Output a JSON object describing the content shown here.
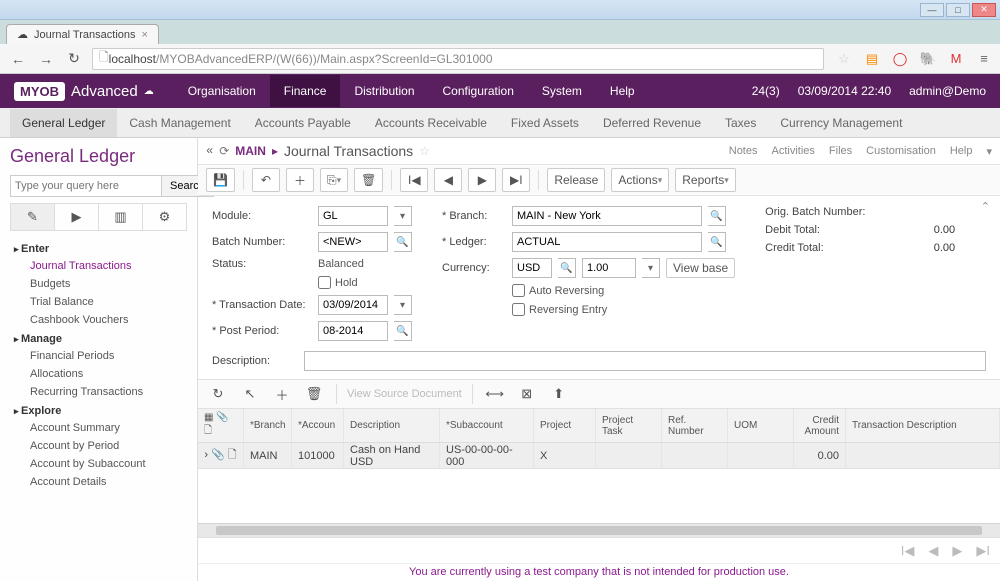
{
  "browser": {
    "tab_title": "Journal Transactions",
    "url_host": "localhost",
    "url_path": "/MYOBAdvancedERP/(W(66))/Main.aspx?ScreenId=GL301000"
  },
  "header": {
    "logo_badge": "MYOB",
    "logo_text": "Advanced",
    "nav": [
      "Organisation",
      "Finance",
      "Distribution",
      "Configuration",
      "System",
      "Help"
    ],
    "nav_active": 1,
    "notif": "24(3)",
    "datetime": "03/09/2014 22:40",
    "user": "admin@Demo"
  },
  "subnav": {
    "items": [
      "General Ledger",
      "Cash Management",
      "Accounts Payable",
      "Accounts Receivable",
      "Fixed Assets",
      "Deferred Revenue",
      "Taxes",
      "Currency Management"
    ],
    "active": 0
  },
  "sidebar": {
    "title": "General Ledger",
    "search_placeholder": "Type your query here",
    "search_btn": "Search",
    "groups": [
      {
        "label": "Enter",
        "items": [
          "Journal Transactions",
          "Budgets",
          "Trial Balance",
          "Cashbook Vouchers"
        ],
        "active": 0
      },
      {
        "label": "Manage",
        "items": [
          "Financial Periods",
          "Allocations",
          "Recurring Transactions"
        ]
      },
      {
        "label": "Explore",
        "items": [
          "Account Summary",
          "Account by Period",
          "Account by Subaccount",
          "Account Details"
        ]
      }
    ]
  },
  "breadcrumb": {
    "main": "MAIN",
    "title": "Journal Transactions",
    "right": [
      "Notes",
      "Activities",
      "Files",
      "Customisation",
      "Help"
    ]
  },
  "toolbar": {
    "release": "Release",
    "actions": "Actions",
    "reports": "Reports"
  },
  "form": {
    "module_label": "Module:",
    "module": "GL",
    "batch_label": "Batch Number:",
    "batch": "<NEW>",
    "status_label": "Status:",
    "status": "Balanced",
    "hold": "Hold",
    "tdate_label": "Transaction Date:",
    "tdate": "03/09/2014",
    "period_label": "Post Period:",
    "period": "08-2014",
    "branch_label": "Branch:",
    "branch": "MAIN - New York",
    "ledger_label": "Ledger:",
    "ledger": "ACTUAL",
    "currency_label": "Currency:",
    "currency": "USD",
    "rate": "1.00",
    "viewbase": "View base",
    "autorev": "Auto Reversing",
    "reventry": "Reversing Entry",
    "origbatch_label": "Orig. Batch Number:",
    "debit_label": "Debit Total:",
    "debit": "0.00",
    "credit_label": "Credit Total:",
    "credit": "0.00",
    "desc_label": "Description:"
  },
  "grid_toolbar": {
    "view_source": "View Source Document"
  },
  "grid": {
    "headers": [
      "*Branch",
      "*Accoun",
      "Description",
      "*Subaccount",
      "Project",
      "Project Task",
      "Ref. Number",
      "UOM",
      "Credit Amount",
      "Transaction Description"
    ],
    "row": {
      "branch": "MAIN",
      "account": "101000",
      "desc": "Cash on Hand USD",
      "sub": "US-00-00-00-000",
      "project": "X",
      "credit": "0.00"
    }
  },
  "footer": "You are currently using a test company that is not intended for production use."
}
